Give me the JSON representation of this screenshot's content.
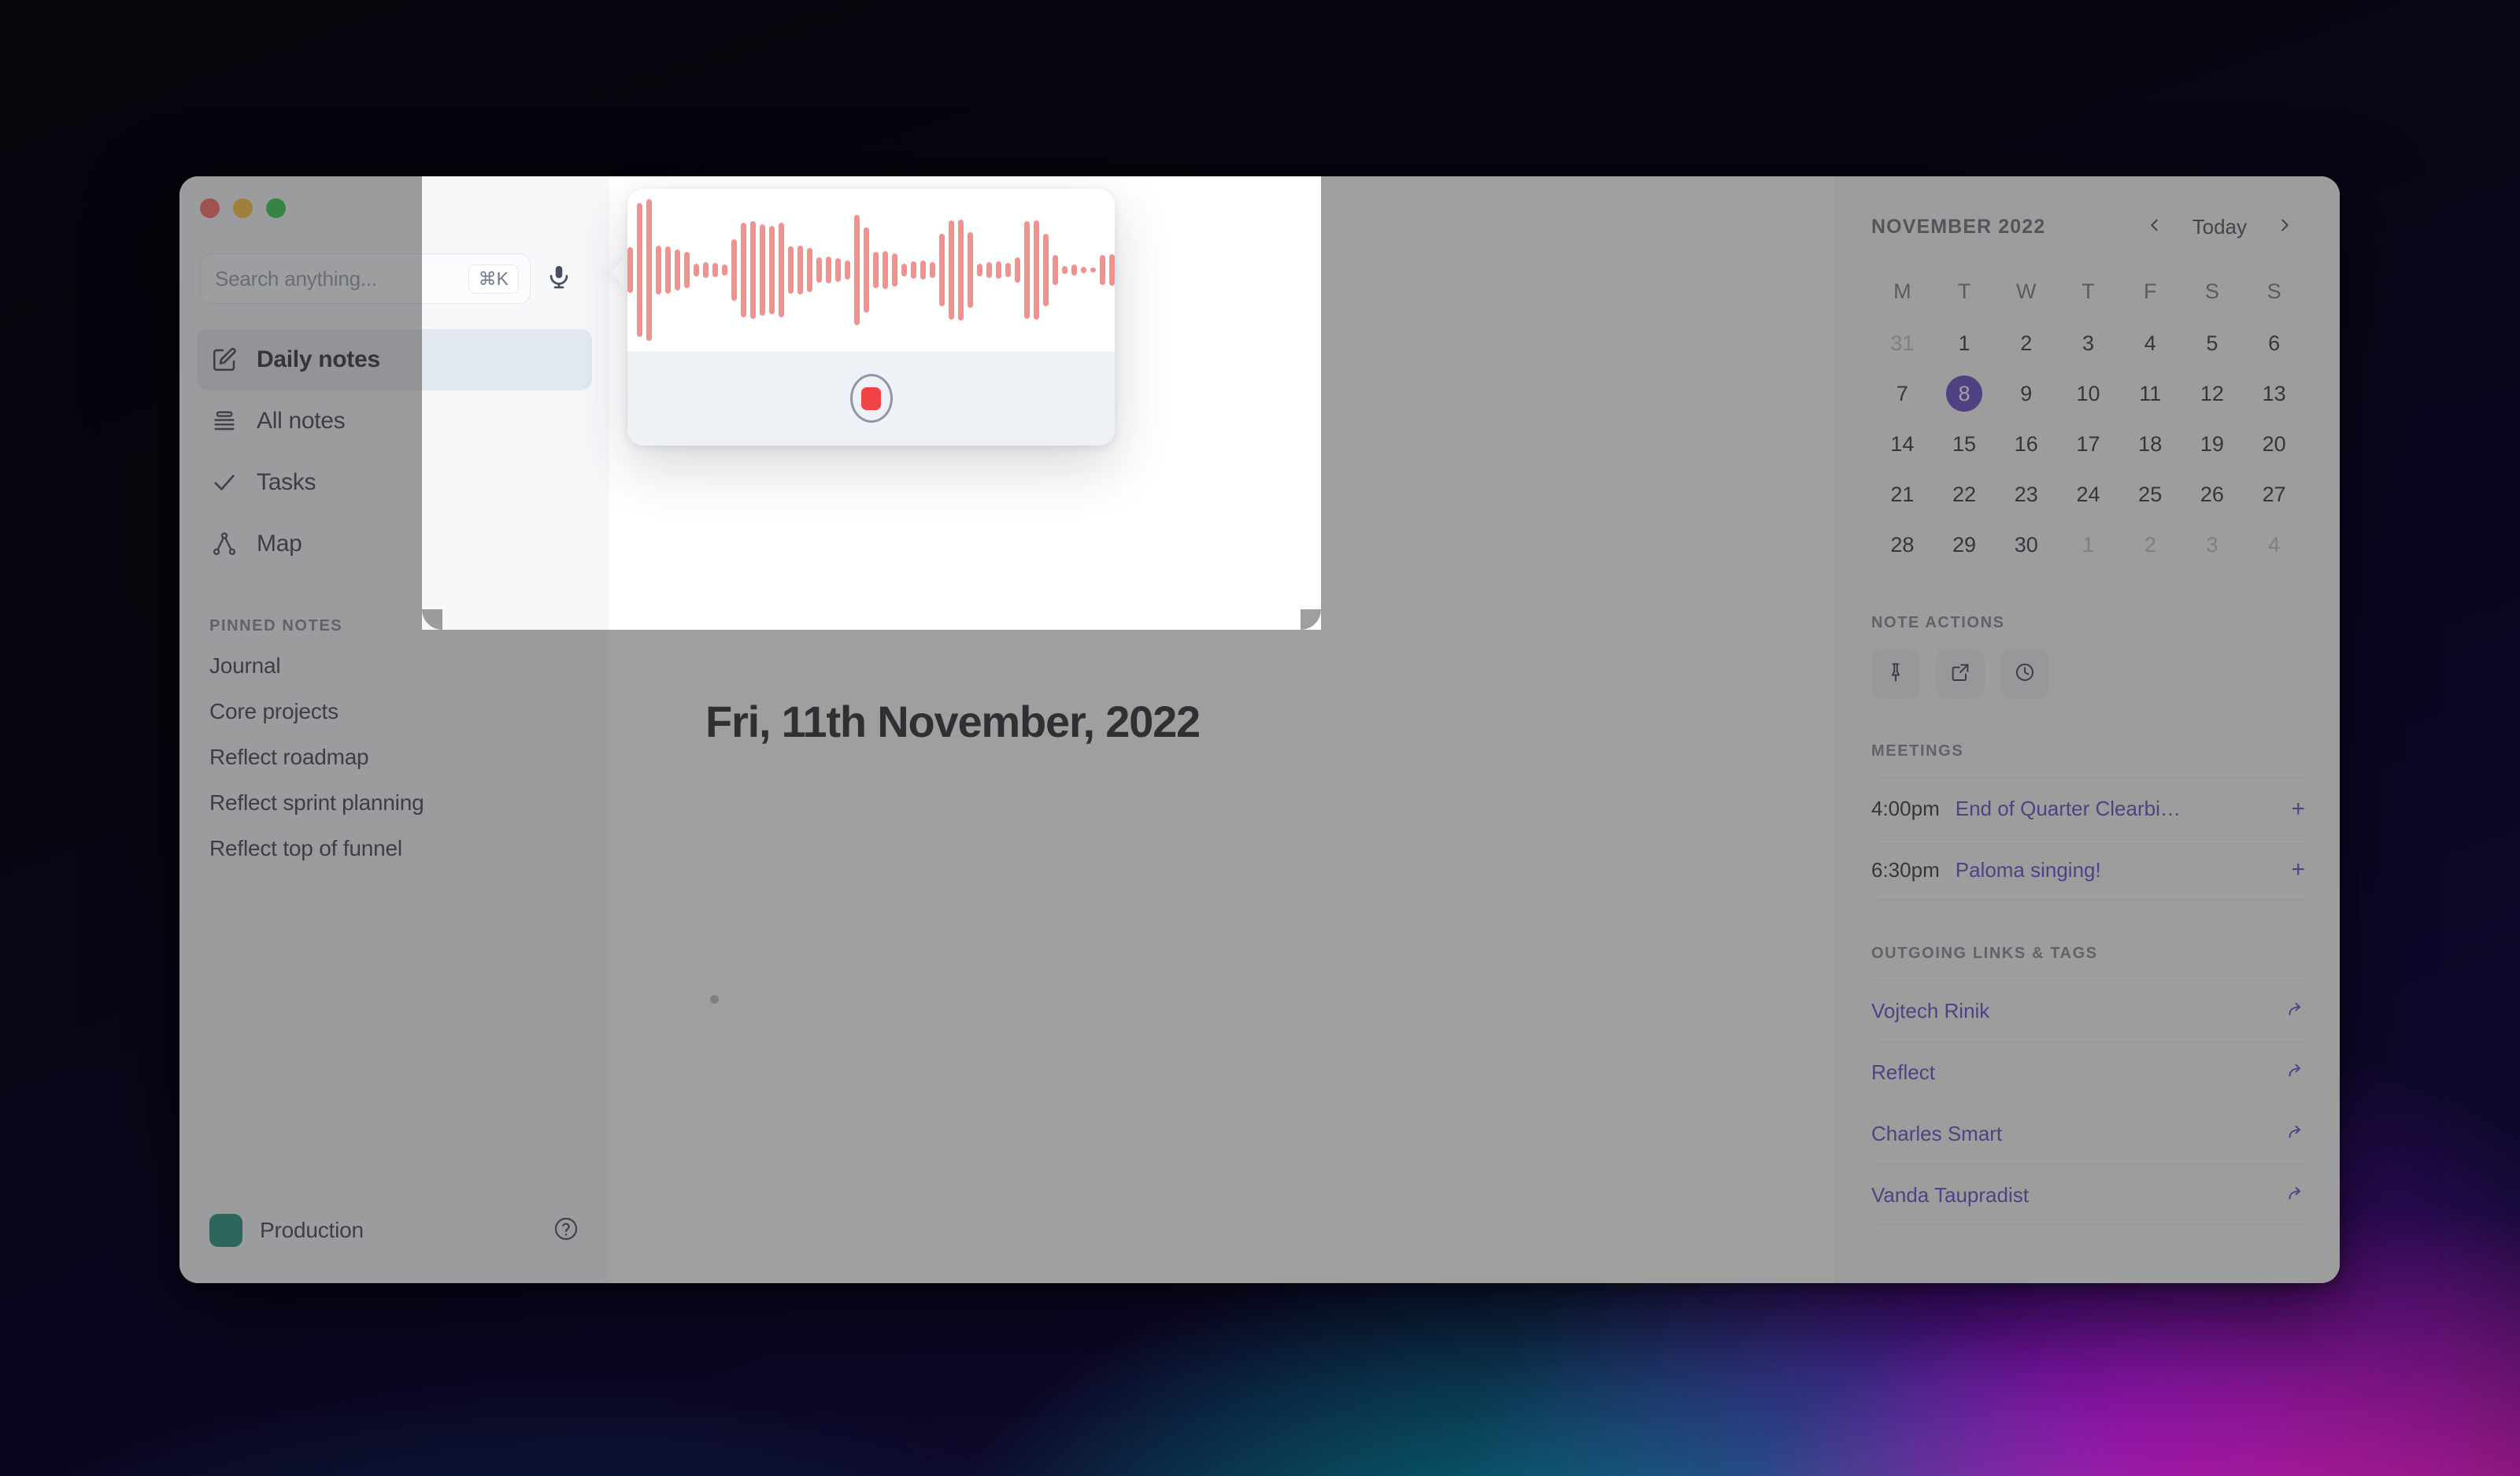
{
  "window": {
    "traffic_lights": [
      "close",
      "minimize",
      "zoom"
    ]
  },
  "search": {
    "placeholder": "Search anything...",
    "shortcut": "⌘K",
    "mic_icon": "microphone-icon"
  },
  "sidebar": {
    "nav": [
      {
        "label": "Daily notes",
        "icon": "pencil-square-icon",
        "active": true
      },
      {
        "label": "All notes",
        "icon": "list-lines-icon",
        "active": false
      },
      {
        "label": "Tasks",
        "icon": "check-icon",
        "active": false
      },
      {
        "label": "Map",
        "icon": "graph-node-icon",
        "active": false
      }
    ],
    "pinned_title": "PINNED NOTES",
    "pinned": [
      "Journal",
      "Core projects",
      "Reflect roadmap",
      "Reflect sprint planning",
      "Reflect top of funnel"
    ],
    "footer": {
      "workspace": "Production",
      "workspace_color": "#0d8a73",
      "help_icon": "question-circle-icon"
    }
  },
  "note": {
    "title": "Fri, 11th November, 2022",
    "first_bullet": ""
  },
  "calendar": {
    "month_label": "NOVEMBER 2022",
    "prev_label": "‹",
    "today_label": "Today",
    "next_label": "›",
    "day_headers": [
      "M",
      "T",
      "W",
      "T",
      "F",
      "S",
      "S"
    ],
    "weeks": [
      [
        {
          "n": "31",
          "muted": true
        },
        {
          "n": "1"
        },
        {
          "n": "2"
        },
        {
          "n": "3"
        },
        {
          "n": "4"
        },
        {
          "n": "5"
        },
        {
          "n": "6"
        }
      ],
      [
        {
          "n": "7"
        },
        {
          "n": "8",
          "today": true
        },
        {
          "n": "9"
        },
        {
          "n": "10"
        },
        {
          "n": "11"
        },
        {
          "n": "12"
        },
        {
          "n": "13"
        }
      ],
      [
        {
          "n": "14"
        },
        {
          "n": "15"
        },
        {
          "n": "16"
        },
        {
          "n": "17"
        },
        {
          "n": "18"
        },
        {
          "n": "19"
        },
        {
          "n": "20"
        }
      ],
      [
        {
          "n": "21"
        },
        {
          "n": "22"
        },
        {
          "n": "23"
        },
        {
          "n": "24"
        },
        {
          "n": "25"
        },
        {
          "n": "26"
        },
        {
          "n": "27"
        }
      ],
      [
        {
          "n": "28"
        },
        {
          "n": "29"
        },
        {
          "n": "30"
        },
        {
          "n": "1",
          "muted": true
        },
        {
          "n": "2",
          "muted": true
        },
        {
          "n": "3",
          "muted": true
        },
        {
          "n": "4",
          "muted": true
        }
      ]
    ],
    "today_color": "#5b3cc4"
  },
  "note_actions": {
    "title": "NOTE ACTIONS",
    "buttons": [
      {
        "icon": "pin-icon"
      },
      {
        "icon": "open-external-icon"
      },
      {
        "icon": "clock-history-icon"
      }
    ]
  },
  "meetings": {
    "title": "MEETINGS",
    "items": [
      {
        "time": "4:00pm",
        "name": "End of Quarter Clearbi…",
        "add": "+"
      },
      {
        "time": "6:30pm",
        "name": "Paloma singing!",
        "add": "+"
      }
    ]
  },
  "links": {
    "title": "OUTGOING LINKS & TAGS",
    "items": [
      {
        "name": "Vojtech Rinik",
        "icon": "arrow-forward-icon"
      },
      {
        "name": "Reflect",
        "icon": "arrow-forward-icon"
      },
      {
        "name": "Charles Smart",
        "icon": "arrow-forward-icon"
      },
      {
        "name": "Vanda Taupradist",
        "icon": "arrow-forward-icon"
      }
    ]
  },
  "recorder": {
    "state": "recording",
    "stop_icon": "stop-square-icon",
    "wave_color": "#f4918e",
    "stop_color": "#f04343",
    "waveform": [
      6,
      4,
      28,
      78,
      86,
      58,
      170,
      180,
      62,
      60,
      52,
      46,
      16,
      20,
      18,
      14,
      78,
      120,
      124,
      116,
      112,
      120,
      60,
      62,
      56,
      32,
      34,
      30,
      24,
      140,
      108,
      46,
      48,
      42,
      16,
      22,
      24,
      20,
      92,
      126,
      128,
      96,
      16,
      20,
      22,
      18,
      32,
      124,
      126,
      92,
      38,
      10,
      14,
      8,
      6,
      38,
      40,
      34,
      80,
      68,
      70,
      64
    ]
  }
}
